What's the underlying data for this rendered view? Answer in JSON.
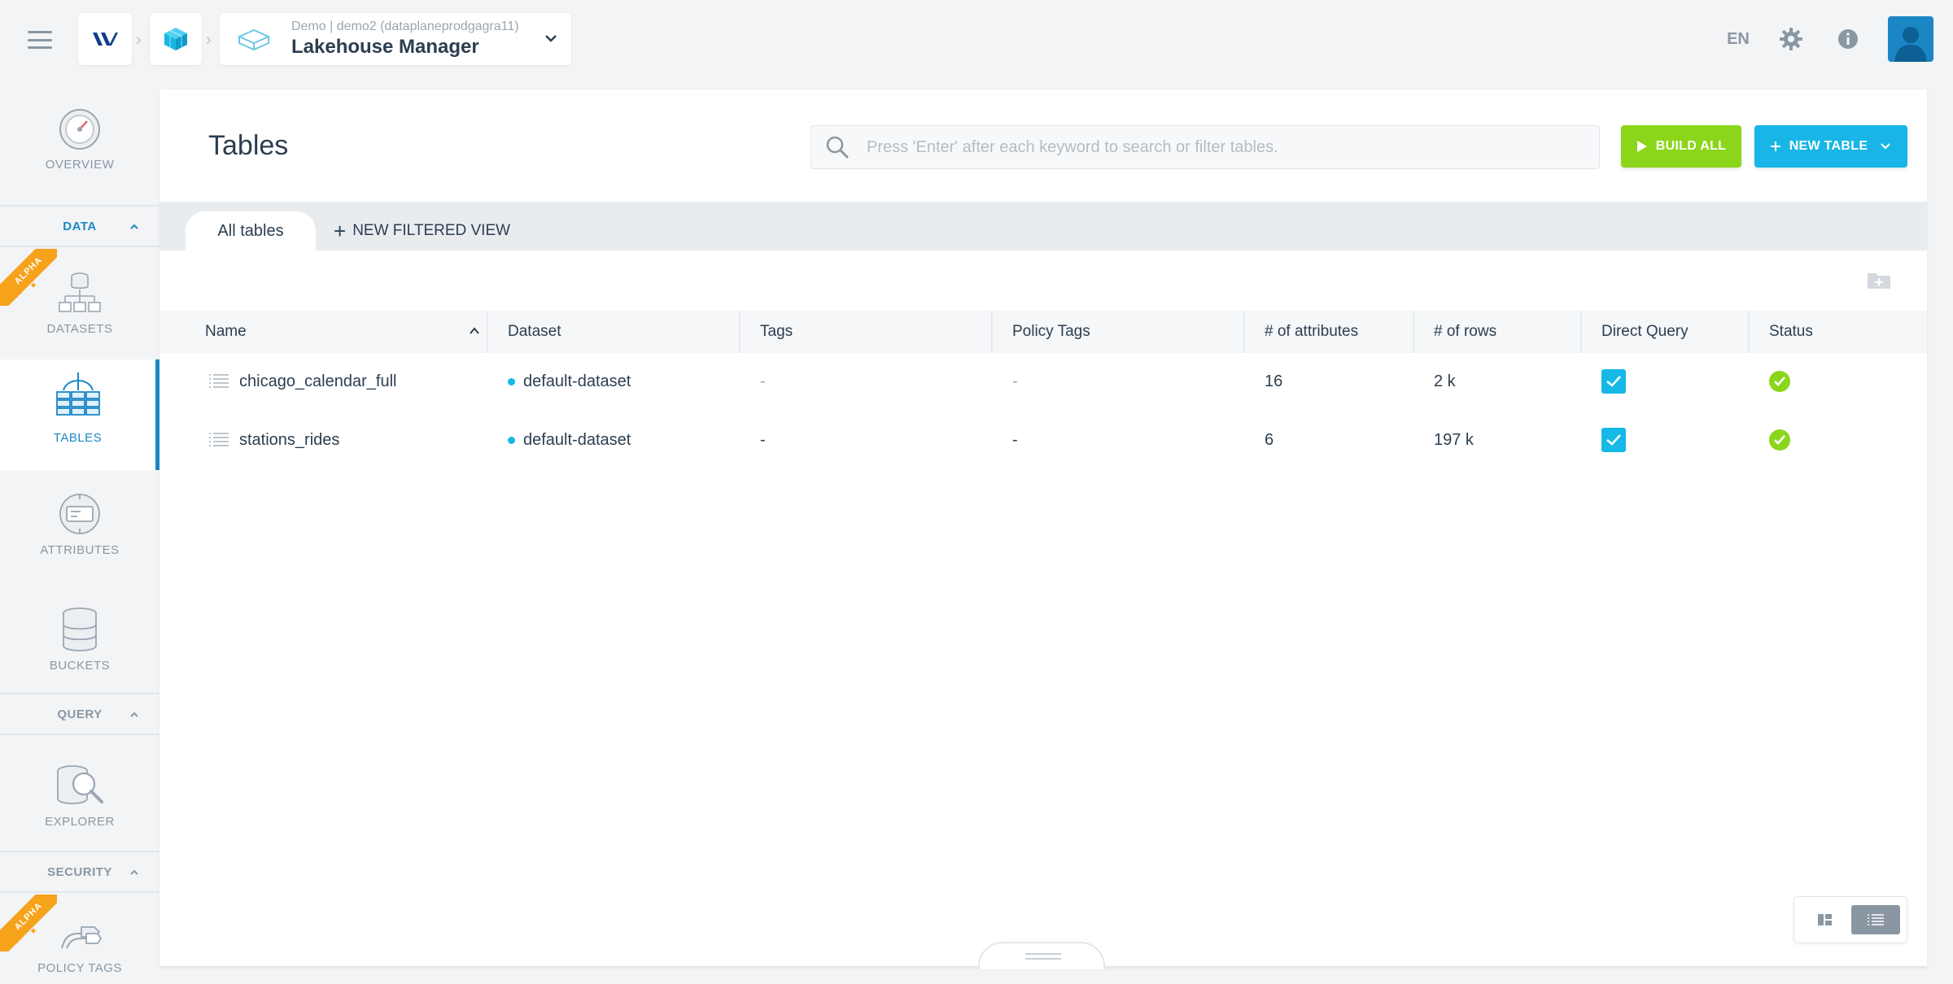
{
  "topbar": {
    "breadcrumb_sub": "Demo | demo2 (dataplaneprodgagra11)",
    "breadcrumb_title": "Lakehouse Manager",
    "language": "EN",
    "icons": [
      "menu-icon",
      "app-logo-icon",
      "cube-icon",
      "lakehouse-icon",
      "chevron-down-icon",
      "gear-icon",
      "info-icon",
      "user-avatar-icon"
    ]
  },
  "sidebar": {
    "overview": "OVERVIEW",
    "section_data": "DATA",
    "datasets": "DATASETS",
    "tables": "TABLES",
    "attributes": "ATTRIBUTES",
    "buckets": "BUCKETS",
    "section_query": "QUERY",
    "explorer": "EXPLORER",
    "section_security": "SECURITY",
    "policy_tags": "POLICY TAGS",
    "alpha_badge": "ALPHA",
    "active_item": "TABLES"
  },
  "main": {
    "title": "Tables",
    "search_placeholder": "Press 'Enter' after each keyword to search or filter tables.",
    "search_value": "",
    "build_all_label": "BUILD ALL",
    "new_table_label": "NEW TABLE",
    "tabs": [
      {
        "label": "All tables"
      }
    ],
    "new_filtered_view_label": "NEW FILTERED VIEW"
  },
  "table": {
    "columns": [
      "Name",
      "Dataset",
      "Tags",
      "Policy Tags",
      "# of attributes",
      "# of rows",
      "Direct Query",
      "Status"
    ],
    "sorted_by": "Name",
    "sort_direction": "ascending",
    "rows": [
      {
        "name": "chicago_calendar_full",
        "dataset": "default-dataset",
        "tags": "-",
        "policy_tags": "-",
        "attributes": "16",
        "rows": "2 k",
        "direct_query": true,
        "status": "ok"
      },
      {
        "name": "stations_rides",
        "dataset": "default-dataset",
        "tags": "-",
        "policy_tags": "-",
        "attributes": "6",
        "rows": "197 k",
        "direct_query": true,
        "status": "ok"
      }
    ]
  },
  "view_toggle": {
    "active": "list"
  },
  "colors": {
    "accent_blue": "#1e87c5",
    "build_green": "#8bd61a",
    "new_table_cyan": "#18b5e6",
    "alpha_orange": "#f7a21b",
    "status_green": "#8bd61a"
  }
}
